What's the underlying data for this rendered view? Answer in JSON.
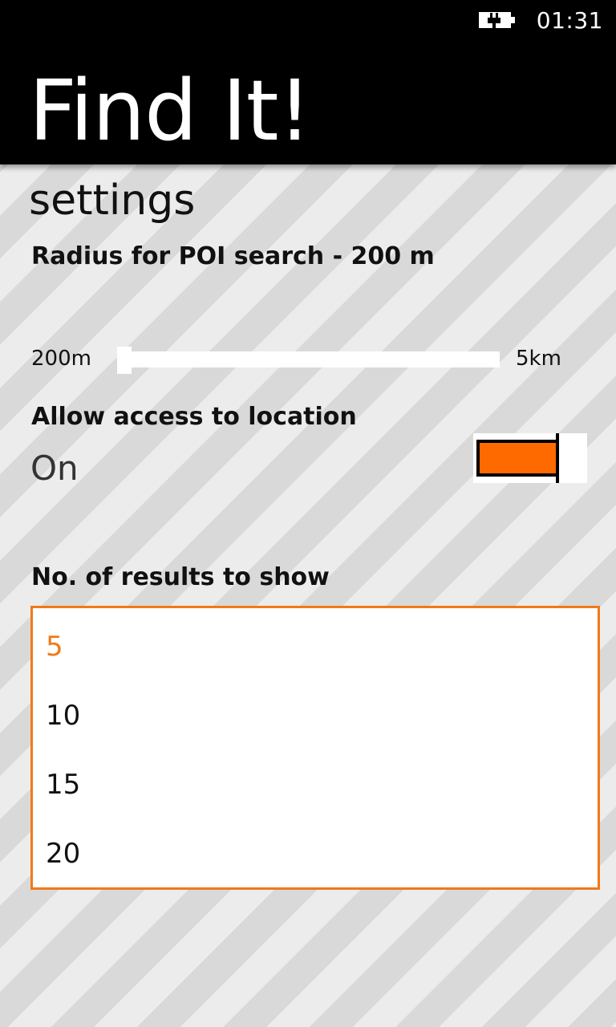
{
  "status_bar": {
    "battery_icon": "battery-charging-icon",
    "time": "01:31"
  },
  "header": {
    "app_title": "Find It!"
  },
  "page": {
    "title": "settings"
  },
  "radius": {
    "label": "Radius for POI search - 200 m",
    "slider_min_label": "200m",
    "slider_max_label": "5km",
    "slider_value_fraction": 0
  },
  "location": {
    "label": "Allow access to location",
    "value": "On",
    "toggle_on": true
  },
  "results": {
    "label": "No. of results to show",
    "options": [
      "5",
      "10",
      "15",
      "20"
    ],
    "selected": "5"
  },
  "colors": {
    "accent": "#f07a1a",
    "toggle_fill": "#ff6a00",
    "header_bg": "#000000",
    "stripe_light": "#ececec",
    "stripe_dark": "#d9d9d9"
  }
}
